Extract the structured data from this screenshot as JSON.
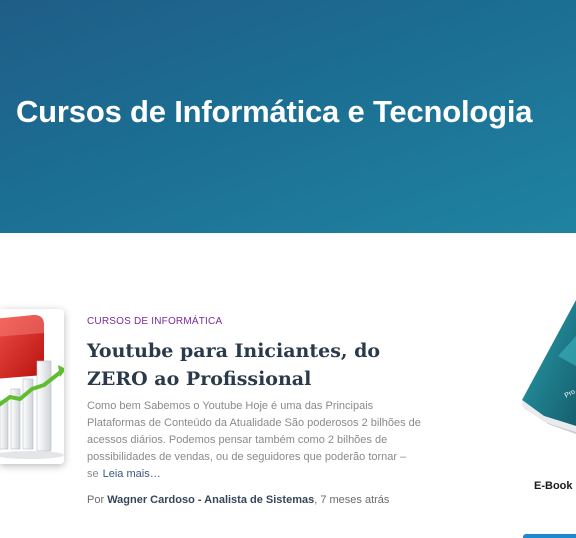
{
  "hero": {
    "title": "Cursos de Informática e Tecnologia"
  },
  "post": {
    "category": "CURSOS DE INFORMÁTICA",
    "title": "Youtube para Iniciantes, do ZERO ao Profissional",
    "excerpt": "Como bem Sabemos o Youtube Hoje é uma das Principais Plataformas de Conteúdo da Atualidade São poderosos 2 bilhões de acessos diários. Podemos pensar também como 2 bilhões de possibilidades de vendas, ou de seguidores que poderão tornar – se",
    "read_more": "Leia mais…",
    "meta_prefix": "Por ",
    "author": "Wagner Cardoso - Analista de Sistemas",
    "meta_time": ", 7 meses atrás"
  },
  "sidebar": {
    "ebook_label": "E-Book C"
  },
  "colors": {
    "hero_start": "#1f5d86",
    "hero_end": "#1f83a0",
    "category": "#7b2a9b",
    "title": "#2b3a4a",
    "button": "#1d8ad0"
  },
  "icons": {
    "thumbnail": "growth-chart-icon",
    "book": "ebook-cover-icon"
  }
}
